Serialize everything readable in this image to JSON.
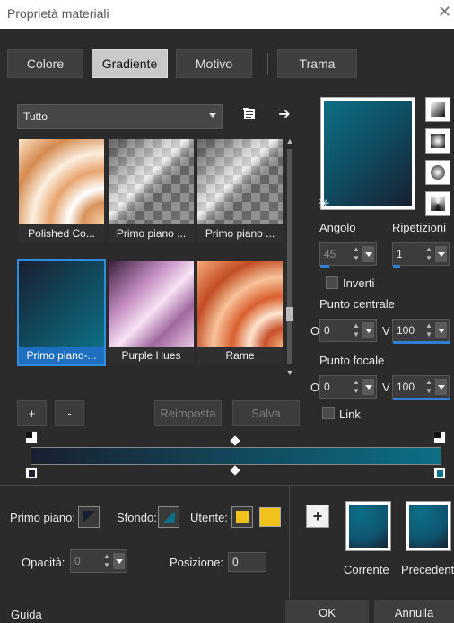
{
  "window": {
    "title": "Proprietà materiali",
    "close_icon": "close-icon"
  },
  "tabs": [
    {
      "label": "Colore",
      "active": false
    },
    {
      "label": "Gradiente",
      "active": true
    },
    {
      "label": "Motivo",
      "active": false
    },
    {
      "label": "Trama",
      "active": false
    }
  ],
  "category_dropdown": {
    "value": "Tutto"
  },
  "gradients": [
    {
      "label": "Polished Co...",
      "selected": false
    },
    {
      "label": "Primo piano ...",
      "selected": false
    },
    {
      "label": "Primo piano ...",
      "selected": false
    },
    {
      "label": "Primo piano-...",
      "selected": true
    },
    {
      "label": "Purple Hues",
      "selected": false
    },
    {
      "label": "Rame",
      "selected": false
    }
  ],
  "actions": {
    "add": "+",
    "remove": "-",
    "reset": "Reimposta",
    "save": "Salva"
  },
  "settings": {
    "angle_label": "Angolo",
    "angle_value": "45",
    "repeats_label": "Ripetizioni",
    "repeats_value": "1",
    "invert_label": "Inverti",
    "center_label": "Punto centrale",
    "center_h_axis": "O",
    "center_h_value": "0",
    "center_v_axis": "V",
    "center_v_value": "100",
    "focal_label": "Punto focale",
    "focal_h_axis": "O",
    "focal_h_value": "0",
    "focal_v_axis": "V",
    "focal_v_value": "100",
    "link_label": "Link"
  },
  "stops": {
    "foreground_label": "Primo piano:",
    "background_label": "Sfondo:",
    "user_label": "Utente:",
    "opacity_label": "Opacità:",
    "opacity_value": "0",
    "position_label": "Posizione:",
    "position_value": "0"
  },
  "compare": {
    "add": "+",
    "current_label": "Corrente",
    "previous_label": "Precedente"
  },
  "footer": {
    "help": "Guida",
    "ok": "OK",
    "cancel": "Annulla"
  },
  "colors": {
    "accent": "#2e7fd6",
    "teal": "#0d6f86",
    "dark_navy": "#182030",
    "user_yellow": "#f2c21c"
  }
}
